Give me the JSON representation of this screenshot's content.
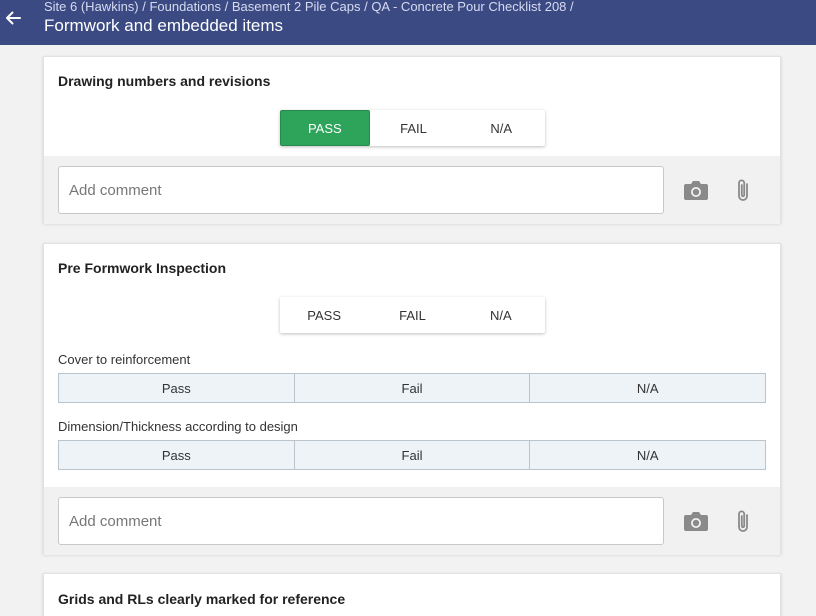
{
  "header": {
    "breadcrumb": "Site 6 (Hawkins) / Foundations / Basement 2 Pile Caps / QA - Concrete Pour Checklist 208 /",
    "title": "Formwork and embedded items"
  },
  "options": {
    "pass": "PASS",
    "fail": "FAIL",
    "na": "N/A"
  },
  "sub_options": {
    "pass": "Pass",
    "fail": "Fail",
    "na": "N/A"
  },
  "comment_placeholder": "Add comment",
  "cards": [
    {
      "title": "Drawing numbers and revisions",
      "selected": "PASS"
    },
    {
      "title": "Pre Formwork Inspection",
      "selected": null,
      "sub_items": [
        {
          "label": "Cover to reinforcement"
        },
        {
          "label": "Dimension/Thickness according to design"
        }
      ]
    },
    {
      "title": "Grids and RLs clearly marked for reference"
    }
  ],
  "colors": {
    "header": "#3c4a84",
    "pass_active": "#2ea45a"
  },
  "icons": {
    "back": "arrow-left-icon",
    "camera": "camera-icon",
    "attach": "paperclip-icon"
  }
}
